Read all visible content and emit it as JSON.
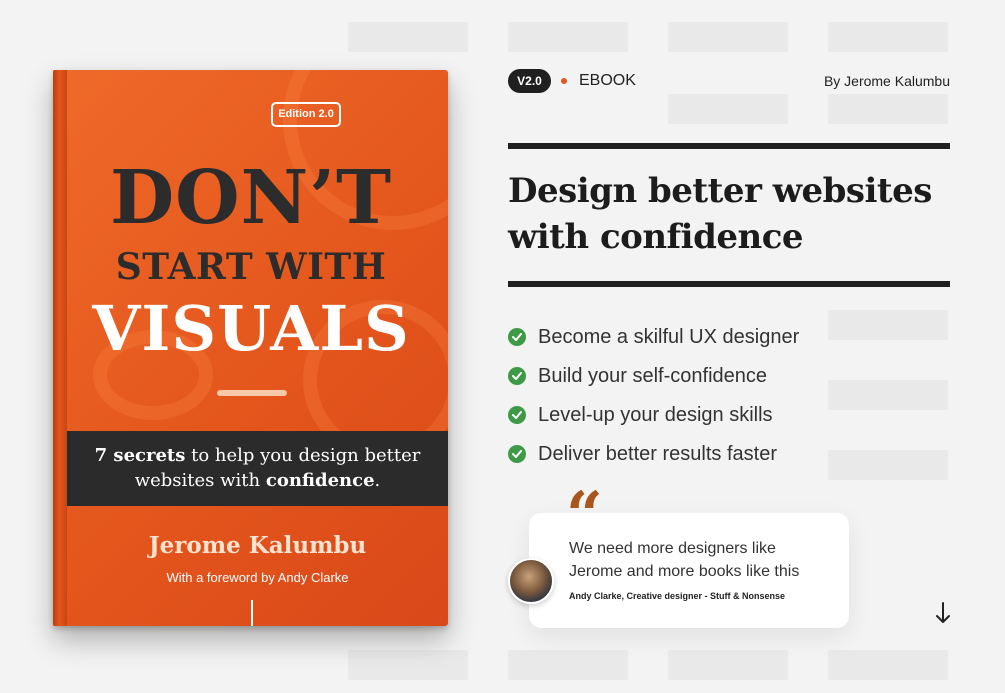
{
  "book": {
    "edition": "Edition 2.0",
    "title_line1": "DON’T",
    "title_line2": "START WITH",
    "title_line3": "VISUALS",
    "band_line1_bold": "7 secrets",
    "band_line1_rest": " to help you design better",
    "band_line2_start": "websites with ",
    "band_line2_bold": "confidence",
    "band_line2_end": ".",
    "author": "Jerome Kalumbu",
    "foreword": "With a foreword by Andy Clarke"
  },
  "meta": {
    "version": "V2.0",
    "type": "EBOOK",
    "author": "By Jerome Kalumbu"
  },
  "headline": {
    "line1": "Design better websites",
    "line2": "with confidence"
  },
  "benefits": [
    "Become a skilful UX designer",
    "Build your self-confidence",
    "Level-up your design skills",
    "Deliver better results faster"
  ],
  "testimonial": {
    "quote_mark": "“",
    "line1": "We need more designers like",
    "line2": "Jerome and more books like this",
    "attribution": "Andy Clarke, Creative designer - Stuff & Nonsense"
  },
  "icons": {
    "check": "check-circle-icon",
    "arrow": "arrow-down-icon"
  },
  "colors": {
    "book_orange": "#e4561c",
    "dark": "#1f1f1f",
    "check_green": "#3f9a48"
  }
}
